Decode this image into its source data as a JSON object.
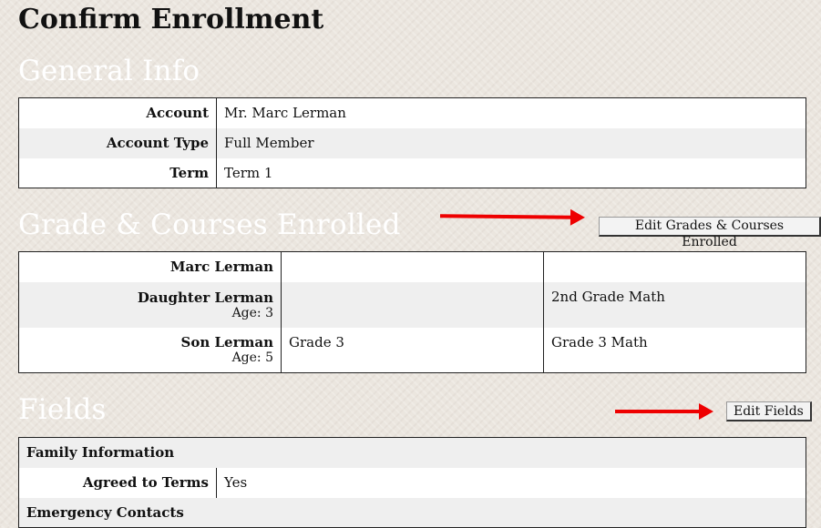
{
  "page": {
    "title": "Confirm Enrollment"
  },
  "general_info": {
    "heading": "General Info",
    "rows": [
      {
        "label": "Account",
        "value": "Mr. Marc Lerman"
      },
      {
        "label": "Account Type",
        "value": "Full Member"
      },
      {
        "label": "Term",
        "value": "Term 1"
      }
    ]
  },
  "grades": {
    "heading": "Grade & Courses Enrolled",
    "edit_button": "Edit Grades & Courses Enrolled",
    "rows": [
      {
        "name": "Marc Lerman",
        "age": "",
        "grade": "",
        "course": ""
      },
      {
        "name": "Daughter Lerman",
        "age": "Age: 3",
        "grade": "",
        "course": "2nd Grade Math"
      },
      {
        "name": "Son Lerman",
        "age": "Age: 5",
        "grade": "Grade 3",
        "course": "Grade 3 Math"
      }
    ]
  },
  "fields": {
    "heading": "Fields",
    "edit_button": "Edit Fields",
    "group1": "Family Information",
    "agreed_label": "Agreed to Terms",
    "agreed_value": "Yes",
    "group2": "Emergency Contacts"
  },
  "annotations": {
    "arrow_color": "#e00000"
  }
}
